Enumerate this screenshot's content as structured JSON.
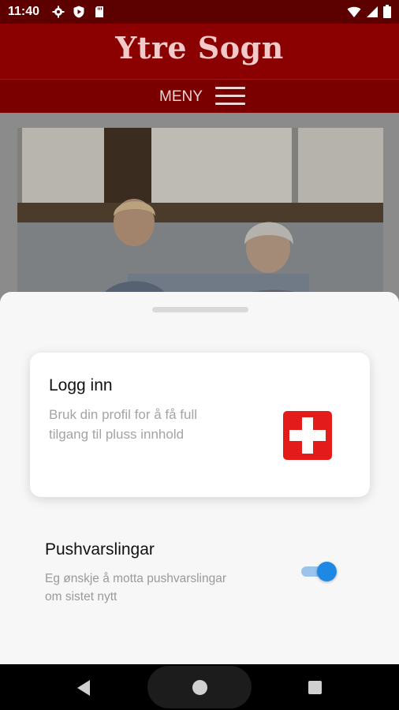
{
  "status_bar": {
    "time": "11:40",
    "icons": [
      "gear-icon",
      "shield-play-icon",
      "sd-card-icon",
      "wifi-icon",
      "signal-icon",
      "battery-icon"
    ]
  },
  "header": {
    "logo_text": "Ytre Sogn",
    "menu_label": "MENY"
  },
  "sheet": {
    "login_card": {
      "title": "Logg inn",
      "description": "Bruk din profil for å få full tilgang til pluss innhold",
      "icon": "red-cross-icon"
    },
    "push": {
      "title": "Pushvarslingar",
      "description": "Eg ønskje å motta pushvarslingar om sistet nytt",
      "enabled": true
    }
  },
  "colors": {
    "brand_red": "#8b0000",
    "toggle_blue": "#1e88e5",
    "cross_red": "#e31b1b"
  }
}
